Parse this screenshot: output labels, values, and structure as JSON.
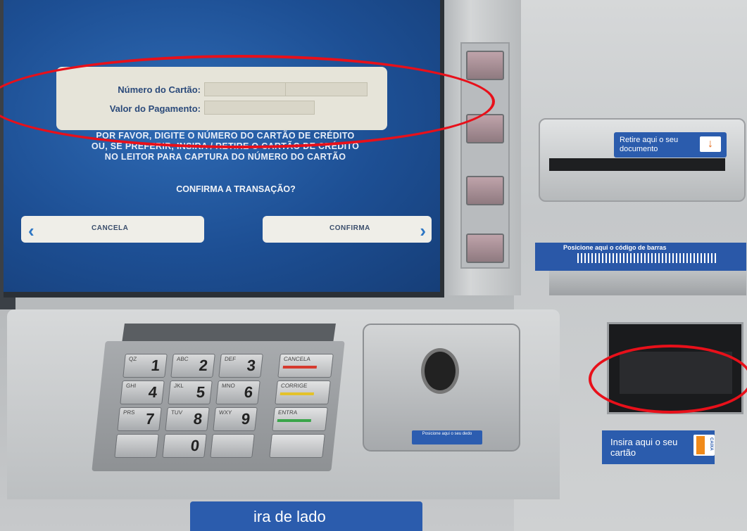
{
  "screen": {
    "form": {
      "card_number_label": "Número do Cartão:",
      "payment_value_label": "Valor do Pagamento:"
    },
    "instructions": [
      "POR FAVOR, DIGITE O NÚMERO DO CARTÃO DE CRÉDITO",
      "OU, SE PREFERIR, INSIRA / RETIRE O CARTÃO DE CRÉDITO",
      "NO LEITOR PARA CAPTURA DO NÚMERO DO CARTÃO"
    ],
    "question": "CONFIRMA A TRANSAÇÃO?",
    "cancel_label": "CANCELA",
    "confirm_label": "CONFIRMA"
  },
  "keypad": {
    "keys": [
      {
        "num": "1",
        "letters": "QZ"
      },
      {
        "num": "2",
        "letters": "ABC"
      },
      {
        "num": "3",
        "letters": "DEF"
      },
      {
        "num": "4",
        "letters": "GHI"
      },
      {
        "num": "5",
        "letters": "JKL"
      },
      {
        "num": "6",
        "letters": "MNO"
      },
      {
        "num": "7",
        "letters": "PRS"
      },
      {
        "num": "8",
        "letters": "TUV"
      },
      {
        "num": "9",
        "letters": "WXY"
      },
      {
        "num": "0",
        "letters": ""
      }
    ],
    "cancel": "CANCELA",
    "correct": "CORRIGE",
    "enter": "ENTRA"
  },
  "biometric": {
    "label": "Posicione aqui o seu dedo"
  },
  "document_slot": {
    "label": "Retire aqui o seu documento"
  },
  "barcode": {
    "label": "Posicione aqui o código de barras"
  },
  "card_slot": {
    "label": "Insira aqui o seu cartão",
    "badge": "CAIXA"
  },
  "bottom": {
    "label": "ira de lado"
  },
  "colors": {
    "screen_blue": "#1d4f94",
    "highlight_red": "#e8101a",
    "brand_blue": "#2b5cad"
  }
}
